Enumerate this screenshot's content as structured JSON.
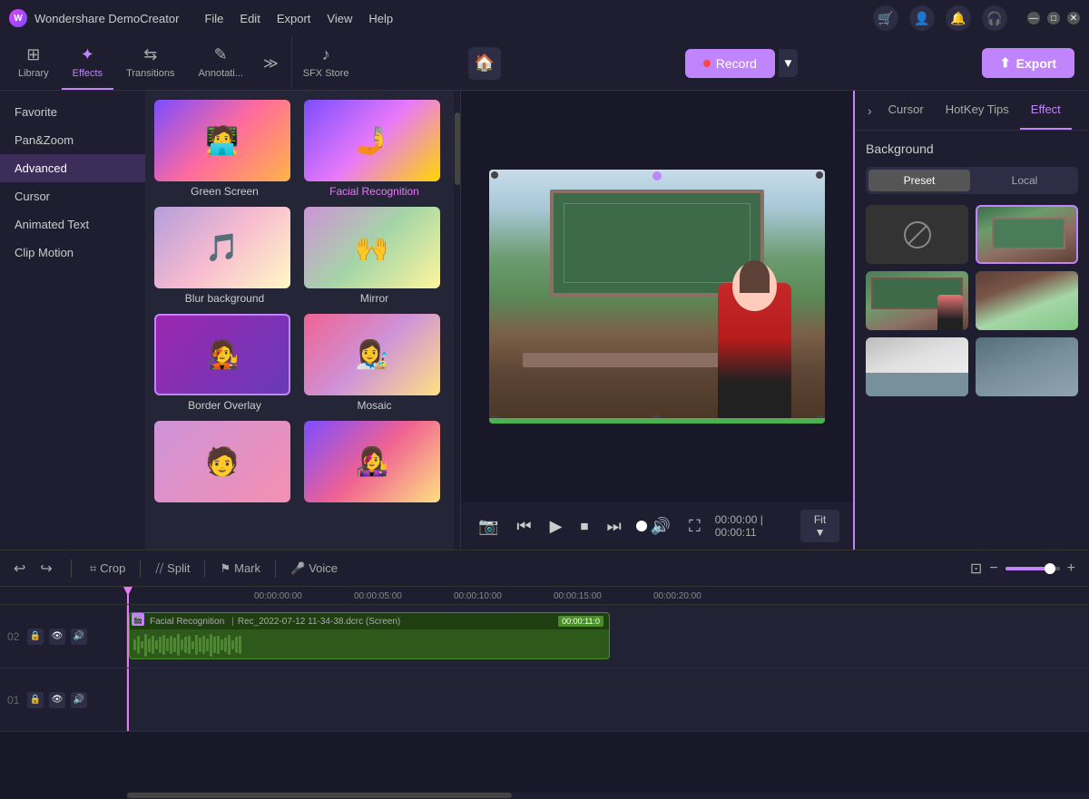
{
  "app": {
    "name": "Wondershare DemoCreator",
    "logo": "W"
  },
  "menu": {
    "items": [
      "File",
      "Edit",
      "Export",
      "View",
      "Help"
    ]
  },
  "toolbar": {
    "tabs": [
      {
        "id": "library",
        "label": "Library",
        "icon": "⊞"
      },
      {
        "id": "effects",
        "label": "Effects",
        "icon": "✦",
        "active": true
      },
      {
        "id": "transitions",
        "label": "Transitions",
        "icon": "⇆"
      },
      {
        "id": "annotations",
        "label": "Annotati...",
        "icon": "✎"
      },
      {
        "id": "sfx",
        "label": "SFX Store",
        "icon": "♪"
      }
    ],
    "export_label": "Export"
  },
  "left_nav": {
    "items": [
      {
        "id": "favorite",
        "label": "Favorite"
      },
      {
        "id": "pan_zoom",
        "label": "Pan&Zoom"
      },
      {
        "id": "advanced",
        "label": "Advanced",
        "active": true
      },
      {
        "id": "cursor",
        "label": "Cursor"
      },
      {
        "id": "animated_text",
        "label": "Animated Text"
      },
      {
        "id": "clip_motion",
        "label": "Clip Motion"
      }
    ]
  },
  "effects": {
    "items": [
      {
        "id": "green_screen",
        "label": "Green Screen",
        "active": false
      },
      {
        "id": "facial_recognition",
        "label": "Facial Recognition",
        "active": true
      },
      {
        "id": "blur_background",
        "label": "Blur background",
        "active": false
      },
      {
        "id": "mirror",
        "label": "Mirror",
        "active": false
      },
      {
        "id": "border_overlay",
        "label": "Border Overlay",
        "selected": true
      },
      {
        "id": "mosaic",
        "label": "Mosaic",
        "active": false
      },
      {
        "id": "partial1",
        "label": "",
        "active": false
      },
      {
        "id": "partial2",
        "label": "",
        "active": false
      }
    ]
  },
  "record": {
    "label": "Record"
  },
  "video": {
    "current_time": "00:00:00",
    "total_time": "00:00:11",
    "fit_label": "Fit"
  },
  "right_panel": {
    "tabs": [
      "Cursor",
      "HotKey Tips",
      "Effect"
    ],
    "active_tab": "Effect",
    "section_title": "Background",
    "preset_tabs": [
      "Preset",
      "Local"
    ],
    "active_preset": "Preset",
    "backgrounds": [
      {
        "id": "none",
        "type": "none"
      },
      {
        "id": "classroom1",
        "type": "classroom1",
        "selected": true
      },
      {
        "id": "classroom2",
        "type": "classroom2"
      },
      {
        "id": "classroom3",
        "type": "classroom3"
      },
      {
        "id": "office1",
        "type": "office1"
      },
      {
        "id": "office2",
        "type": "office2"
      }
    ]
  },
  "timeline": {
    "tools": [
      {
        "id": "undo",
        "icon": "↩",
        "label": ""
      },
      {
        "id": "redo",
        "icon": "↪",
        "label": ""
      },
      {
        "id": "crop",
        "icon": "⌗",
        "label": "Crop"
      },
      {
        "id": "split",
        "icon": "⧸⧸",
        "label": "Split"
      },
      {
        "id": "mark",
        "icon": "⚑",
        "label": "Mark"
      },
      {
        "id": "voice",
        "icon": "🎤",
        "label": "Voice"
      }
    ],
    "ruler_marks": [
      "00:00:00:00",
      "00:00:05:00",
      "00:00:10:00",
      "00:00:15:00",
      "00:00:20:00"
    ],
    "tracks": [
      {
        "id": "02",
        "num": "02",
        "clip": {
          "label": "Facial Recognition",
          "filename": "Rec_2022-07-12 11-34-38.dcrc (Screen)",
          "time": "00:00:11:0"
        }
      },
      {
        "id": "01",
        "num": "01",
        "clip": null
      }
    ]
  }
}
